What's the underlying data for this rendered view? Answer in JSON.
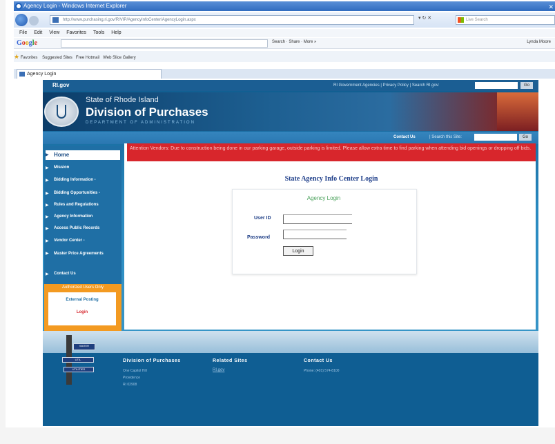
{
  "browser": {
    "title": "Agency Login - Windows Internet Explorer",
    "address": "http://www.purchasing.ri.gov/RIVIP/AgencyInfoCenter/AgencyLogin.aspx",
    "search_placeholder": "Live Search",
    "menu": [
      "File",
      "Edit",
      "View",
      "Favorites",
      "Tools",
      "Help"
    ],
    "google_logo": "Google",
    "google_tools": [
      "Search",
      "Share",
      "More »"
    ],
    "user": "Lynda Moore",
    "favorites": [
      "Favorites",
      "Suggested Sites",
      "Free Hotmail",
      "Web Slice Gallery"
    ],
    "tab": "Agency Login"
  },
  "site": {
    "logo": "RI.gov",
    "top_links": "RI Government Agencies  |  Privacy Policy  |  Search RI.gov:",
    "go_label": "Go",
    "header": {
      "state": "State of Rhode Island",
      "division": "Division of Purchases",
      "department": "DEPARTMENT OF ADMINISTRATION"
    },
    "subbar": {
      "contact": "Contact Us",
      "search_label": "|  Search this Site:"
    },
    "nav": [
      {
        "label": "Home"
      },
      {
        "label": "Mission"
      },
      {
        "label": "Bidding Information -"
      },
      {
        "label": "Bidding Opportunities -"
      },
      {
        "label": "Rules and Regulations"
      },
      {
        "label": "Agency Information"
      },
      {
        "label": "Access Public Records"
      },
      {
        "label": "Vendor Center -"
      },
      {
        "label": "Master Price Agreements"
      },
      {
        "label": "Contact Us"
      }
    ],
    "authorized": {
      "title": "Authorized Users Only",
      "external": "External Posting",
      "login": "Login"
    },
    "alert": "Attention Vendors: Due to construction being done in our parking garage, outside parking is limited. Please allow extra time to find parking when attending bid openings or dropping off bids.",
    "login": {
      "page_title": "State Agency Info Center Login",
      "panel_heading": "Agency Login",
      "user_label": "User ID",
      "password_label": "Password",
      "button": "Login"
    },
    "footer": {
      "col1_title": "Division of Purchases",
      "col1_lines": [
        "One Capitol Hill",
        "Providence",
        "RI 02908"
      ],
      "col2_title": "Related Sites",
      "col2_link": "RI.gov",
      "col3_title": "Contact Us",
      "col3_phone": "Phone: (401) 574-8100",
      "signs": [
        "WATER",
        "UTIL",
        "UTILITIES"
      ]
    }
  }
}
